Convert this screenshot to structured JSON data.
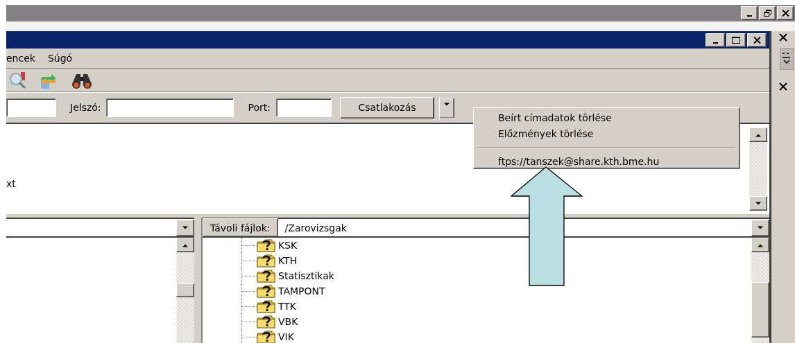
{
  "menu_bar": {
    "items": [
      "encek",
      "Súgó"
    ]
  },
  "quickconnect": {
    "password_label": "Jelszó:",
    "port_label": "Port:",
    "connect_button": "Csatlakozás"
  },
  "history_menu": {
    "items": [
      {
        "kind": "item",
        "label": "Beírt címadatok törlése"
      },
      {
        "kind": "item",
        "label": "Előzmények törlése"
      },
      {
        "kind": "separator"
      },
      {
        "kind": "item",
        "label": "ftps://tanszek@share.kth.bme.hu"
      }
    ]
  },
  "message_log": {
    "lines": [
      "xt"
    ]
  },
  "remote_pane": {
    "label": "Távoli fájlok:",
    "path": "/Zarovizsgak",
    "folders": [
      {
        "name": "KSK"
      },
      {
        "name": "KTH"
      },
      {
        "name": "Statisztikak"
      },
      {
        "name": "TAMPONT"
      },
      {
        "name": "TTK"
      },
      {
        "name": "VBK"
      },
      {
        "name": "VIK"
      }
    ]
  }
}
